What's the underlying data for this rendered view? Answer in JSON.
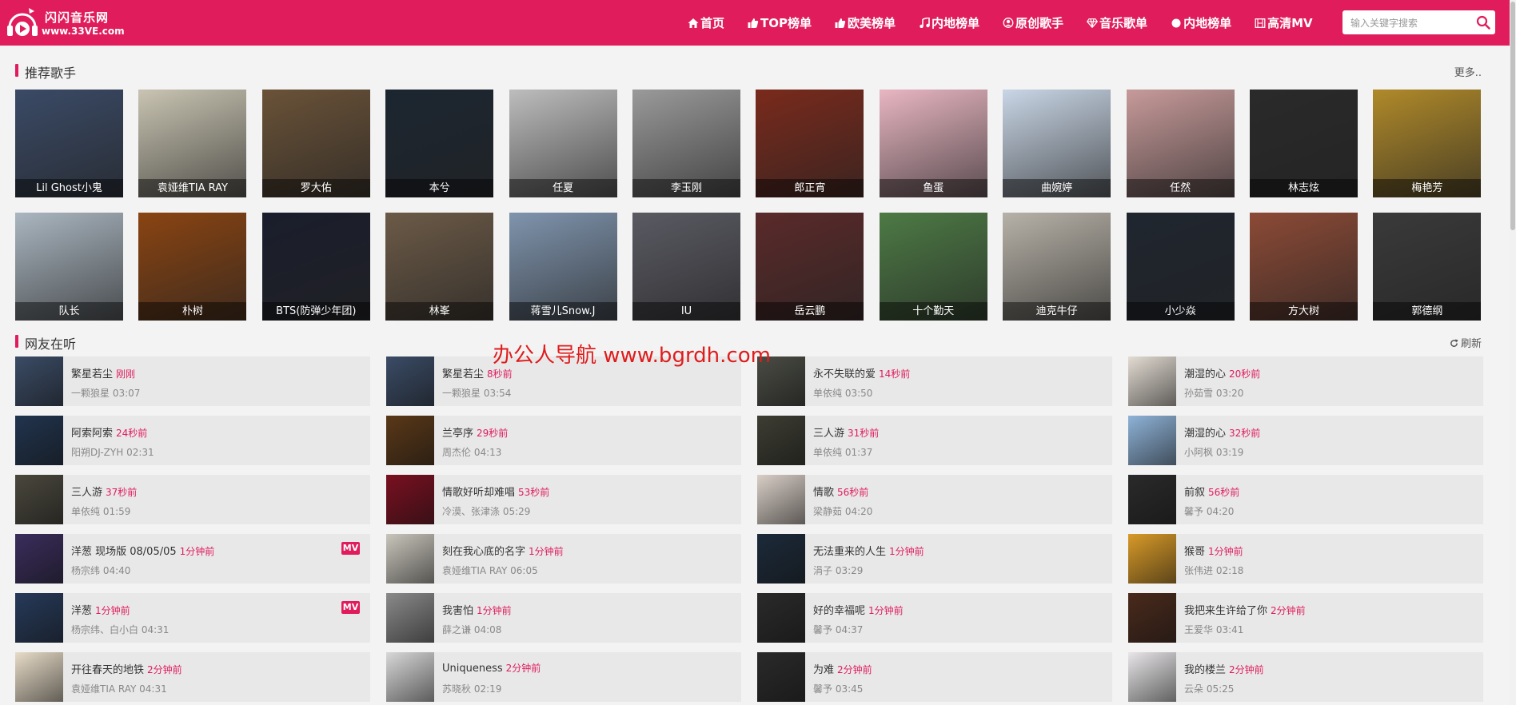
{
  "brand": {
    "name": "闪闪音乐网",
    "domain": "www.33VE.com",
    "accent_color": "#e01c5c"
  },
  "nav": {
    "items": [
      {
        "label": "首页",
        "icon": "home-icon"
      },
      {
        "label": "TOP榜单",
        "icon": "thumbs-up-icon"
      },
      {
        "label": "欧美榜单",
        "icon": "thumbs-up-icon"
      },
      {
        "label": "内地榜单",
        "icon": "music-note-icon"
      },
      {
        "label": "原创歌手",
        "icon": "user-circle-icon"
      },
      {
        "label": "音乐歌单",
        "icon": "diamond-icon"
      },
      {
        "label": "内地榜单",
        "icon": "circle-icon"
      },
      {
        "label": "高清MV",
        "icon": "film-icon"
      }
    ]
  },
  "search": {
    "placeholder": "输入关键字搜索",
    "value": ""
  },
  "recommended": {
    "title": "推荐歌手",
    "more_label": "更多..",
    "singers": [
      {
        "name": "Lil Ghost小鬼",
        "bg": "#3a4a66"
      },
      {
        "name": "袁娅维TIA RAY",
        "bg": "#c9c4b2"
      },
      {
        "name": "罗大佑",
        "bg": "#6a5238"
      },
      {
        "name": "本兮",
        "bg": "#1c2631"
      },
      {
        "name": "任夏",
        "bg": "#bdbdbd"
      },
      {
        "name": "李玉刚",
        "bg": "#9a9a9a"
      },
      {
        "name": "郎正宵",
        "bg": "#7a2a1c"
      },
      {
        "name": "鱼蛋",
        "bg": "#e8b6c2"
      },
      {
        "name": "曲婉婷",
        "bg": "#c9d6e6"
      },
      {
        "name": "任然",
        "bg": "#c79a9a"
      },
      {
        "name": "林志炫",
        "bg": "#2a2a2a"
      },
      {
        "name": "梅艳芳",
        "bg": "#b08a2a"
      },
      {
        "name": "队长",
        "bg": "#aab6c0"
      },
      {
        "name": "朴树",
        "bg": "#8a4412"
      },
      {
        "name": "BTS(防弹少年团)",
        "bg": "#1a1d2c"
      },
      {
        "name": "林峯",
        "bg": "#6c5a47"
      },
      {
        "name": "蒋雪儿Snow.J",
        "bg": "#7f94ad"
      },
      {
        "name": "IU",
        "bg": "#5a5a63"
      },
      {
        "name": "岳云鹏",
        "bg": "#5b2a2a"
      },
      {
        "name": "十个勤天",
        "bg": "#4d7a45"
      },
      {
        "name": "迪克牛仔",
        "bg": "#b7b2a8"
      },
      {
        "name": "小少焱",
        "bg": "#1f2630"
      },
      {
        "name": "方大树",
        "bg": "#8c4a36"
      },
      {
        "name": "郭德纲",
        "bg": "#3a3a3a"
      }
    ]
  },
  "listening": {
    "title": "网友在听",
    "refresh_label": "刷新",
    "songs": [
      {
        "title": "繁星若尘",
        "time": "刚刚",
        "artist": "一颗狼星 03:07",
        "mv": "",
        "bg": "#3b4c66"
      },
      {
        "title": "繁星若尘",
        "time": "8秒前",
        "artist": "一颗狼星 03:54",
        "mv": "",
        "bg": "#3b4c66"
      },
      {
        "title": "永不失联的爱",
        "time": "14秒前",
        "artist": "单依纯 03:50",
        "mv": "",
        "bg": "#4a4c44"
      },
      {
        "title": "潮湿的心",
        "time": "20秒前",
        "artist": "孙茹雪 03:20",
        "mv": "",
        "bg": "#e3dcd3"
      },
      {
        "title": "阿索阿索",
        "time": "24秒前",
        "artist": "阳朔DJ-ZYH 02:31",
        "mv": "",
        "bg": "#21344e"
      },
      {
        "title": "兰亭序",
        "time": "29秒前",
        "artist": "周杰伦 04:13",
        "mv": "",
        "bg": "#5a3818"
      },
      {
        "title": "三人游",
        "time": "31秒前",
        "artist": "单依纯 01:37",
        "mv": "",
        "bg": "#3d3d33"
      },
      {
        "title": "潮湿的心",
        "time": "32秒前",
        "artist": "小阿枫 03:19",
        "mv": "",
        "bg": "#8fb3d8"
      },
      {
        "title": "三人游",
        "time": "37秒前",
        "artist": "单依纯 01:59",
        "mv": "",
        "bg": "#4a483d"
      },
      {
        "title": "情歌好听却难唱",
        "time": "53秒前",
        "artist": "冷漠、张津涤 05:29",
        "mv": "",
        "bg": "#7a1020"
      },
      {
        "title": "情歌",
        "time": "56秒前",
        "artist": "梁静茹 04:20",
        "mv": "",
        "bg": "#d9cfc7"
      },
      {
        "title": "前叙",
        "time": "56秒前",
        "artist": "馨予 04:20",
        "mv": "",
        "bg": "#2a2a2a"
      },
      {
        "title": "洋葱 现场版 08/05/05",
        "time": "1分钟前",
        "artist": "杨宗纬 04:40",
        "mv": "MV",
        "bg": "#3a2d5c"
      },
      {
        "title": "刻在我心底的名字",
        "time": "1分钟前",
        "artist": "袁娅维TIA RAY 06:05",
        "mv": "",
        "bg": "#c8c5bb"
      },
      {
        "title": "无法重来的人生",
        "time": "1分钟前",
        "artist": "涓子 03:29",
        "mv": "",
        "bg": "#1c2a3a"
      },
      {
        "title": "猴哥",
        "time": "1分钟前",
        "artist": "张伟进 02:18",
        "mv": "",
        "bg": "#d89a28"
      },
      {
        "title": "洋葱",
        "time": "1分钟前",
        "artist": "杨宗纬、白小白 04:31",
        "mv": "MV",
        "bg": "#263a5a"
      },
      {
        "title": "我害怕",
        "time": "1分钟前",
        "artist": "薛之谦 04:08",
        "mv": "",
        "bg": "#8a8a8a"
      },
      {
        "title": "好的幸福呢",
        "time": "1分钟前",
        "artist": "馨予 04:37",
        "mv": "",
        "bg": "#2a2a2a"
      },
      {
        "title": "我把来生许给了你",
        "time": "2分钟前",
        "artist": "王爱华 03:41",
        "mv": "",
        "bg": "#4a2a1c"
      },
      {
        "title": "开往春天的地铁",
        "time": "2分钟前",
        "artist": "袁娅维TIA RAY 04:31",
        "mv": "",
        "bg": "#e8dcc8"
      },
      {
        "title": "Uniqueness",
        "time": "2分钟前",
        "artist": "苏晓秋 02:19",
        "mv": "",
        "bg": "#d8d8d8"
      },
      {
        "title": "为难",
        "time": "2分钟前",
        "artist": "馨予 03:45",
        "mv": "",
        "bg": "#2a2a2a"
      },
      {
        "title": "我的楼兰",
        "time": "2分钟前",
        "artist": "云朵 05:25",
        "mv": "",
        "bg": "#e8e6e8"
      }
    ]
  },
  "watermark": "办公人导航 www.bgrdh.com"
}
